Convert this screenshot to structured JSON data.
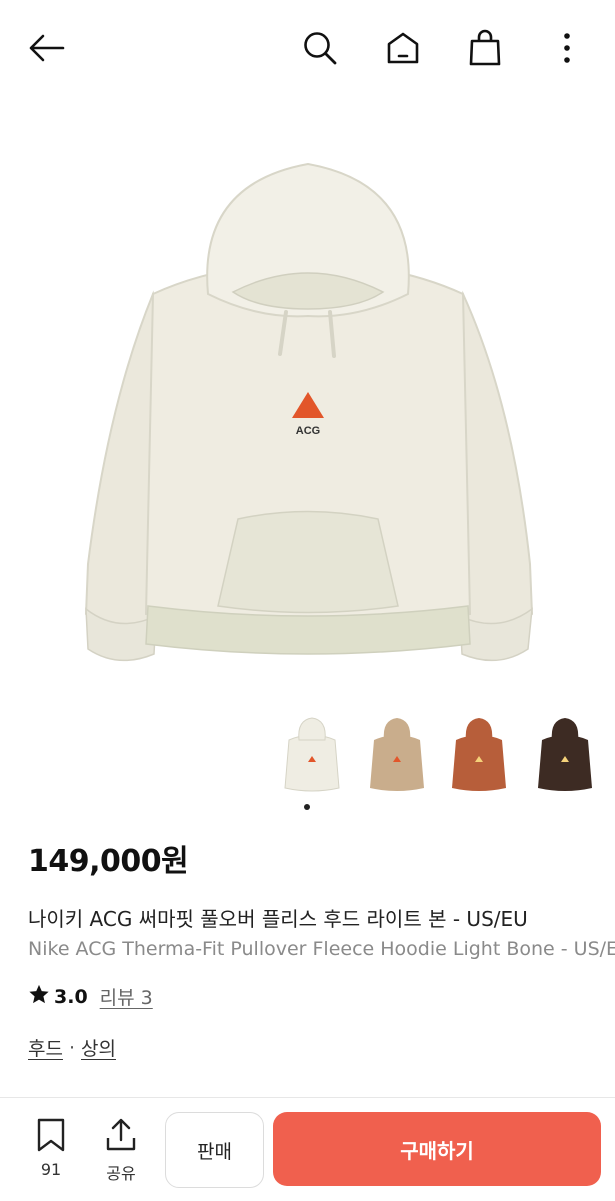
{
  "header": {
    "icons": [
      "back-arrow-icon",
      "search-icon",
      "home-icon",
      "shopping-bag-icon",
      "more-vertical-icon"
    ]
  },
  "product": {
    "price": "149,000원",
    "title_ko": "나이키 ACG 써마핏 풀오버 플리스 후드 라이트 본 - US/EU",
    "title_en": "Nike ACG Therma-Fit Pullover Fleece Hoodie Light Bone - US/EU",
    "rating": "3.0",
    "review_label": "리뷰 3",
    "category_1": "후드",
    "category_sep": "·",
    "category_2": "상의",
    "logo_text": "ACG"
  },
  "thumbnails": [
    {
      "color": "#efede3"
    },
    {
      "color": "#c9ad8c"
    },
    {
      "color": "#b75e3a"
    },
    {
      "color": "#3d2b23"
    }
  ],
  "bottom_bar": {
    "bookmark_count": "91",
    "share_label": "공유",
    "sell_label": "판매",
    "buy_label": "구매하기"
  },
  "colors": {
    "buy_button": "#f0604e",
    "hoodie_body": "#edeade",
    "hoodie_accent": "#e2e3d1",
    "logo": "#e2562a"
  }
}
